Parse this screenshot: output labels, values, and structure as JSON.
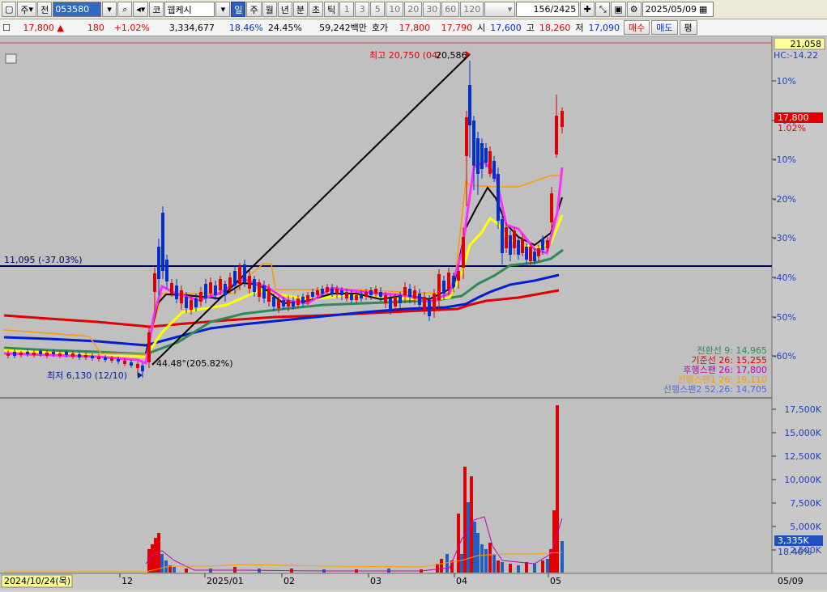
{
  "toolbar": {
    "period_label": "주",
    "prev_label": "전",
    "code_value": "053580",
    "market_label": "코",
    "stock_name": "웹케시",
    "periods": [
      "일",
      "주",
      "월",
      "년",
      "분",
      "초",
      "틱"
    ],
    "active_period": "일",
    "intervals": [
      "1",
      "3",
      "5",
      "10",
      "20",
      "30",
      "60",
      "120"
    ],
    "count_value": "156/2425",
    "date_value": "2025/05/09"
  },
  "quote": {
    "price": "17,800",
    "change": "180",
    "change_pct": "+1.02%",
    "volume": "3,334,677",
    "turnover": "18.46%",
    "ratio": "24.45%",
    "amount": "59,242백만",
    "hoga_label": "호가",
    "ask": "17,800",
    "bid": "17,790",
    "open_label": "시",
    "open": "17,600",
    "high_label": "고",
    "high": "18,260",
    "low_label": "저",
    "low": "17,090",
    "buy_label": "매수",
    "sell_label": "매도",
    "flat_label": "평"
  },
  "price_axis": {
    "top_label": "21,058",
    "hc_label": "HC:-14.22",
    "ticks": [
      "10%",
      "0%",
      "-10%",
      "-20%",
      "-30%",
      "-40%",
      "-50%",
      "-60%"
    ],
    "current_price": "17,800",
    "current_pct": "1.02%"
  },
  "annotations": {
    "high_label": "최고 20,750 (04/",
    "high_value": "20,586",
    "low_label": "최저 6,130 (12/10)",
    "trend_label": "44.48°(205.82%)",
    "hline_label": "11,095 (-37.03%)"
  },
  "legend": [
    {
      "text": "전환선 9: 14,965",
      "color": "#2e8b57"
    },
    {
      "text": "기준선 26: 15,255",
      "color": "#e00000"
    },
    {
      "text": "후행스팬 26: 17,800",
      "color": "#c000c0"
    },
    {
      "text": "선행스팬1 26: 19,110",
      "color": "#ff9900"
    },
    {
      "text": "선행스팬2 52,26: 14,705",
      "color": "#4a70d0"
    }
  ],
  "volume_axis": {
    "ticks": [
      "17,500K",
      "15,000K",
      "12,500K",
      "10,000K",
      "7,500K",
      "5,000K",
      "2,500K"
    ],
    "current_volume": "3,335K",
    "current_pct": "18.46%"
  },
  "time_axis": {
    "start_label": "2024/10/24(목)",
    "ticks": [
      "12",
      "2025/01",
      "02",
      "03",
      "04",
      "05"
    ],
    "end_label": "05/09"
  },
  "colors": {
    "up": "#e00000",
    "down": "#0030d0",
    "background": "#c0c0c0",
    "ma_short": "#ff2bff",
    "ma_mid": "#ffff00",
    "ma_long": "#2e8b57",
    "ma_blue": "#0020d0",
    "ma_red": "#e00000",
    "span": "#ff9900"
  }
}
